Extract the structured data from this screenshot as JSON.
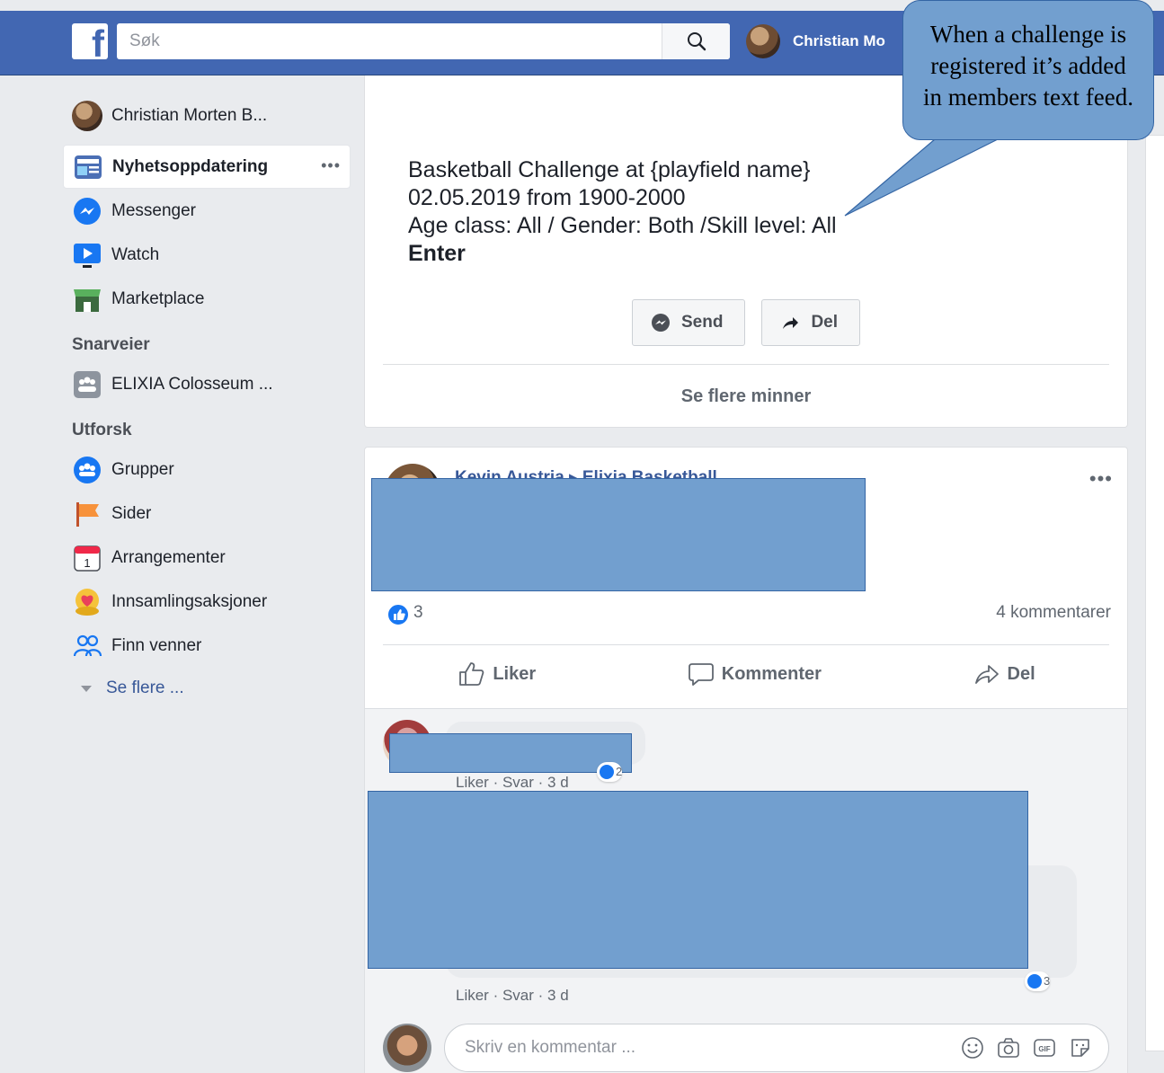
{
  "topbar": {
    "logo": "f",
    "search_placeholder": "Søk",
    "user_name": "Christian Mo"
  },
  "sidebar": {
    "profile": "Christian Morten B...",
    "main": [
      {
        "label": "Nyhetsoppdatering",
        "icon": "news-feed-icon"
      },
      {
        "label": "Messenger",
        "icon": "messenger-icon"
      },
      {
        "label": "Watch",
        "icon": "watch-icon"
      },
      {
        "label": "Marketplace",
        "icon": "marketplace-icon"
      }
    ],
    "shortcuts_heading": "Snarveier",
    "shortcuts": [
      {
        "label": "ELIXIA Colosseum ...",
        "icon": "group-icon"
      }
    ],
    "explore_heading": "Utforsk",
    "explore": [
      {
        "label": "Grupper",
        "icon": "groups-icon"
      },
      {
        "label": "Sider",
        "icon": "pages-flag-icon"
      },
      {
        "label": "Arrangementer",
        "icon": "calendar-icon",
        "day": "1"
      },
      {
        "label": "Innsamlingsaksjoner",
        "icon": "fundraiser-icon"
      },
      {
        "label": "Finn venner",
        "icon": "find-friends-icon"
      }
    ],
    "see_more": "Se flere ..."
  },
  "memory": {
    "line1": "Basketball Challenge at {playfield name}",
    "line2": "02.05.2019 from 1900-2000",
    "line3": "Age class: All / Gender: Both /Skill level: All",
    "enter": "Enter",
    "send_label": "Send",
    "share_label": "Del",
    "see_more": "Se flere minner"
  },
  "post": {
    "header": "Kevin Austria ▸ Elixia Basketball",
    "reactions": "3",
    "comments": "4 kommentarer",
    "like_label": "Liker",
    "comment_label": "Kommenter",
    "share_label": "Del"
  },
  "comments": [
    {
      "meta": "Liker · Svar · 3 d",
      "reactions": "2"
    },
    {
      "meta": "Liker · Svar · 3 d",
      "reactions": "3"
    }
  ],
  "compose": {
    "placeholder": "Skriv en kommentar ...",
    "icons": [
      "emoji-icon",
      "camera-icon",
      "gif-icon",
      "sticker-icon"
    ],
    "gif": "GIF"
  },
  "callout": {
    "line1": "When a challenge is",
    "line2": "registered it’s added",
    "line3": "in members text feed."
  },
  "colors": {
    "topbar": "#4267b2",
    "link": "#385898",
    "redaction": "#729fcf"
  }
}
